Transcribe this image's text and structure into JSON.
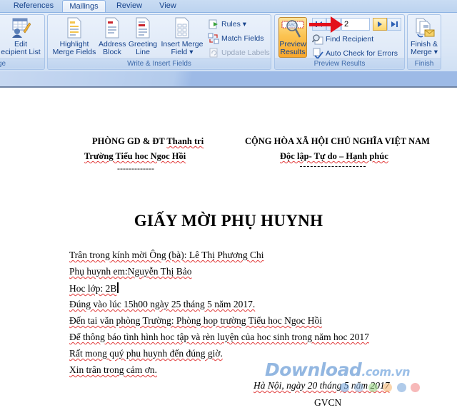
{
  "ribbon": {
    "tabs": [
      {
        "label": "References",
        "active": false
      },
      {
        "label": "Mailings",
        "active": true
      },
      {
        "label": "Review",
        "active": false
      },
      {
        "label": "View",
        "active": false
      }
    ],
    "groups": {
      "start": {
        "label": "ge",
        "edit_recipient_list": [
          "Edit",
          "ecipient List"
        ]
      },
      "write_insert": {
        "label": "Write & Insert Fields",
        "highlight": [
          "Highlight",
          "Merge Fields"
        ],
        "address_block": [
          "Address",
          "Block"
        ],
        "greeting_line": [
          "Greeting",
          "Line"
        ],
        "insert_merge_field": [
          "Insert Merge",
          "Field ▾"
        ],
        "rules": "Rules ▾",
        "match_fields": "Match Fields",
        "update_labels": "Update Labels"
      },
      "preview": {
        "label": "Preview Results",
        "preview_results": [
          "Preview",
          "Results"
        ],
        "record_number": "2",
        "find_recipient": "Find Recipient",
        "auto_check": "Auto Check for Errors"
      },
      "finish": {
        "label": "Finish",
        "finish_merge": [
          "Finish &",
          "Merge ▾"
        ]
      }
    },
    "accent_color": "#f9a72c",
    "annotation_arrow_color": "#e3101a"
  },
  "document": {
    "header_left": {
      "line1_prefix": "PHÒNG GD & ĐT ",
      "line1_suffix": "Thanh tri",
      "line2": "Trường Tiểu hoc Ngoc Hồi",
      "separator": "-------------"
    },
    "header_right": {
      "line1": "CỘNG HÒA XÃ HỘI CHỦ NGHĨA VIỆT NAM",
      "line2": "Độc lập- Tự do – Hạnh phúc"
    },
    "title": "GIẤY MỜI PHỤ HUYNH",
    "lines": [
      "Trân trong kính mời Ông (bà): Lê Thị Phương Chi",
      "Phụ huynh em:Nguyễn Thị Bảo",
      "Hoc lớp: 2B",
      "Đúng vào lúc 15h00 ngày 25 tháng 5 năm 2017.",
      "Đến tai văn phòng Trường: Phòng hop trường Tiểu hoc Ngoc Hồi",
      "Để thông báo tình hình hoc tập và rèn luyện của hoc sinh trong năm hoc 2017",
      "Rất mong quý phu huynh đến đúng giờ.",
      "Xin trân trong cảm ơn."
    ],
    "date_line": "Hà Nội, ngày 20 tháng 5  năm 2017",
    "signature": "GVCN"
  },
  "watermark": {
    "main": "Download",
    "suffix": ".com.vn",
    "dot_colors": [
      "#6fa0d8",
      "#9cc0e6",
      "#8fd07a",
      "#f6b36a",
      "#6fa0d8",
      "#f07f7f"
    ]
  }
}
